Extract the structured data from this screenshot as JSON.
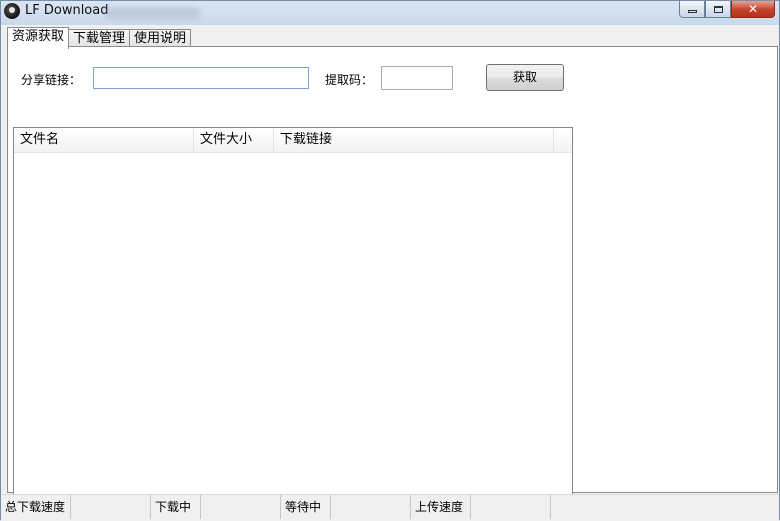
{
  "window": {
    "title": "LF Download"
  },
  "tabs": [
    {
      "label": "资源获取",
      "active": true
    },
    {
      "label": "下载管理",
      "active": false
    },
    {
      "label": "使用说明",
      "active": false
    }
  ],
  "form": {
    "share_link_label": "分享链接：",
    "share_link_value": "",
    "code_label": "提取码：",
    "code_value": "",
    "fetch_button": "获取"
  },
  "file_list": {
    "columns": [
      "文件名",
      "文件大小",
      "下载链接"
    ],
    "rows": []
  },
  "statusbar": {
    "total_speed_label": "总下载速度",
    "total_speed_value": "",
    "downloading_label": "下载中",
    "downloading_value": "",
    "waiting_label": "等待中",
    "waiting_value": "",
    "upload_speed_label": "上传速度",
    "upload_speed_value": ""
  },
  "colors": {
    "close_button": "#c4412b",
    "titlebar": "#c9d8ec"
  }
}
